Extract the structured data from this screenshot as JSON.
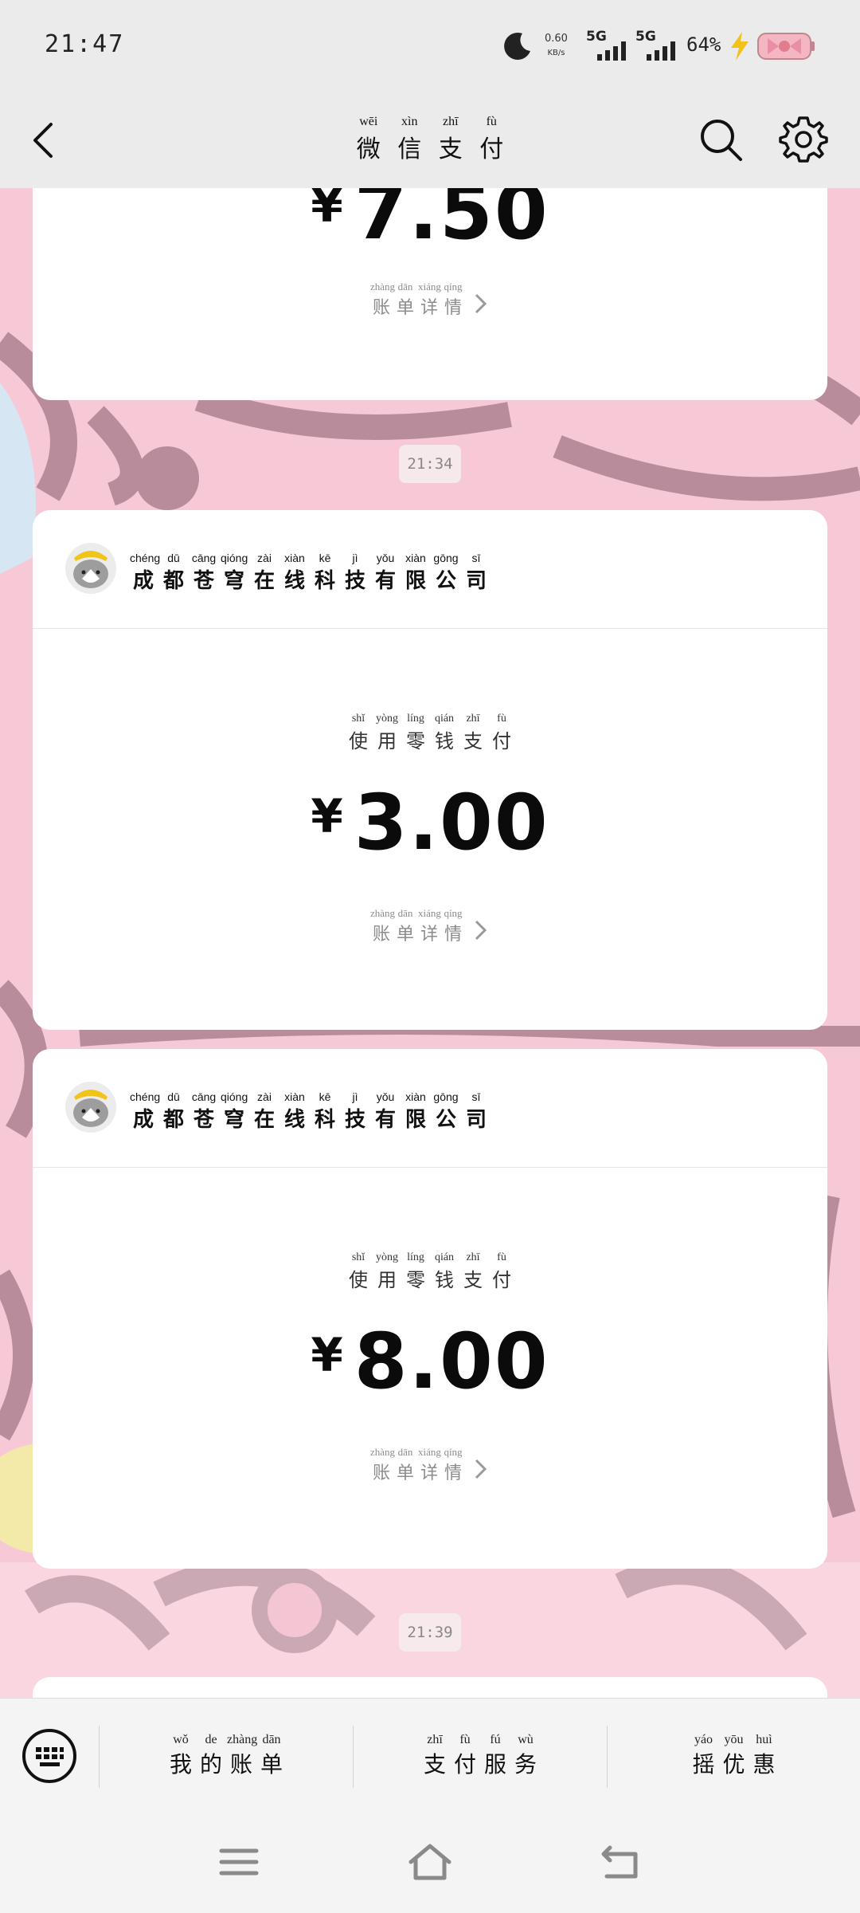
{
  "status_bar": {
    "time": "21:47",
    "net_speed_value": "0.60",
    "net_speed_unit": "KB/s",
    "sim1_label": "5G",
    "sim2_label": "5G",
    "battery_percent": "64%",
    "icons": [
      "moon-icon",
      "signal-icon",
      "battery-charging-icon"
    ]
  },
  "nav": {
    "title_pinyin": [
      "wēi",
      "xìn",
      "zhī",
      "fù"
    ],
    "title_hanzi": [
      "微",
      "信",
      "支",
      "付"
    ],
    "icons": [
      "back-icon",
      "search-icon",
      "gear-icon"
    ]
  },
  "cards": [
    {
      "amount_currency": "¥",
      "amount_value": "7.50",
      "bill_pinyin": [
        "zhàng",
        "dān",
        "xiáng",
        "qíng"
      ],
      "bill_hanzi": [
        "账",
        "单",
        "详",
        "情"
      ]
    },
    {
      "merchant_pinyin": [
        "chéng",
        "dū",
        "cāng",
        "qióng",
        "zài",
        "xiàn",
        "kē",
        "jì",
        "yǒu",
        "xiàn",
        "gōng",
        "sī"
      ],
      "merchant_hanzi": [
        "成",
        "都",
        "苍",
        "穹",
        "在",
        "线",
        "科",
        "技",
        "有",
        "限",
        "公",
        "司"
      ],
      "method_pinyin": [
        "shǐ",
        "yòng",
        "líng",
        "qián",
        "zhī",
        "fù"
      ],
      "method_hanzi": [
        "使",
        "用",
        "零",
        "钱",
        "支",
        "付"
      ],
      "amount_currency": "¥",
      "amount_value": "3.00",
      "bill_pinyin": [
        "zhàng",
        "dān",
        "xiáng",
        "qíng"
      ],
      "bill_hanzi": [
        "账",
        "单",
        "详",
        "情"
      ]
    },
    {
      "merchant_pinyin": [
        "chéng",
        "dū",
        "cāng",
        "qióng",
        "zài",
        "xiàn",
        "kē",
        "jì",
        "yǒu",
        "xiàn",
        "gōng",
        "sī"
      ],
      "merchant_hanzi": [
        "成",
        "都",
        "苍",
        "穹",
        "在",
        "线",
        "科",
        "技",
        "有",
        "限",
        "公",
        "司"
      ],
      "method_pinyin": [
        "shǐ",
        "yòng",
        "líng",
        "qián",
        "zhī",
        "fù"
      ],
      "method_hanzi": [
        "使",
        "用",
        "零",
        "钱",
        "支",
        "付"
      ],
      "amount_currency": "¥",
      "amount_value": "8.00",
      "bill_pinyin": [
        "zhàng",
        "dān",
        "xiáng",
        "qíng"
      ],
      "bill_hanzi": [
        "账",
        "单",
        "详",
        "情"
      ]
    }
  ],
  "timestamps": [
    "21:34",
    "21:39"
  ],
  "bottom_menu": [
    {
      "pinyin": [
        "wǒ",
        "de",
        "zhàng",
        "dān"
      ],
      "hanzi": [
        "我",
        "的",
        "账",
        "单"
      ]
    },
    {
      "pinyin": [
        "zhī",
        "fù",
        "fú",
        "wù"
      ],
      "hanzi": [
        "支",
        "付",
        "服",
        "务"
      ]
    },
    {
      "pinyin": [
        "yáo",
        "yōu",
        "huì"
      ],
      "hanzi": [
        "摇",
        "优",
        "惠"
      ]
    }
  ],
  "colors": {
    "wallpaper_pink": "#f7c9d6",
    "wallpaper_mauve": "#b98c9c",
    "wallpaper_blue": "#d6e6f2",
    "card_white": "#ffffff",
    "bar_gray": "#ebebeb"
  }
}
